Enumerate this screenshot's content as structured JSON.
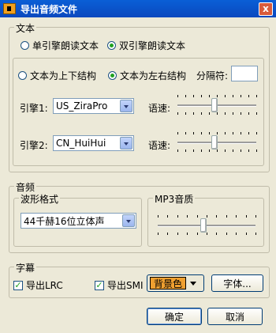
{
  "window": {
    "title": "导出音频文件",
    "close_label": "x"
  },
  "text_group": {
    "title": "文本",
    "mode_single": "单引擎朗读文本",
    "mode_dual": "双引擎朗读文本",
    "layout_tb": "文本为上下结构",
    "layout_lr": "文本为左右结构",
    "separator_label": "分隔符:",
    "separator_value": "",
    "engine1_label": "引擎1:",
    "engine1_value": "US_ZiraPro",
    "engine2_label": "引擎2:",
    "engine2_value": "CN_HuiHui",
    "speed_label": "语速:",
    "speed1_level": 0.47,
    "speed2_level": 0.47
  },
  "audio_group": {
    "title": "音频",
    "waveform_title": "波形格式",
    "waveform_value": "44千赫16位立体声",
    "mp3_title": "MP3音质",
    "mp3_level": 0.47
  },
  "subtitle_group": {
    "title": "字幕",
    "export_lrc": "导出LRC",
    "export_smi": "导出SMI",
    "bg_color_label": "背景色",
    "font_button": "字体..."
  },
  "buttons": {
    "ok": "确定",
    "cancel": "取消"
  },
  "colors": {
    "title_bar": "#0b49be",
    "bg_swatch": "#f0a030",
    "check_mark": "#21a121"
  }
}
